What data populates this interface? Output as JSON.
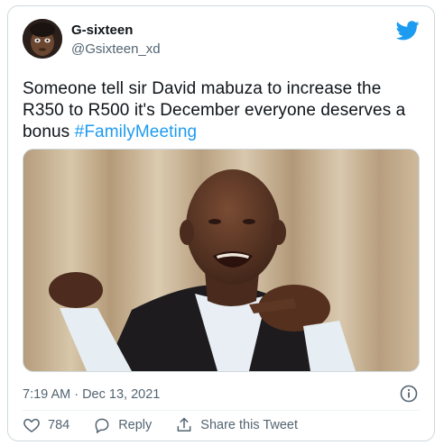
{
  "tweet": {
    "author_name": "G-sixteen",
    "author_handle": "@Gsixteen_xd",
    "text": "Someone tell sir David mabuza to increase the R350 to R500 it's December everyone deserves a bonus ",
    "hashtag": "#FamilyMeeting",
    "timestamp": "7:19 AM · Dec 13, 2021",
    "like_count": "784",
    "reply_label": "Reply",
    "share_label": "Share this Tweet"
  },
  "icons": {
    "brand": "twitter-bird-icon",
    "info": "info-icon",
    "like": "heart-icon",
    "reply": "reply-icon",
    "share": "share-icon"
  },
  "colors": {
    "brand_blue": "#1d9bf0",
    "text": "#0f1419",
    "muted": "#536471",
    "border": "#cfd9de"
  }
}
